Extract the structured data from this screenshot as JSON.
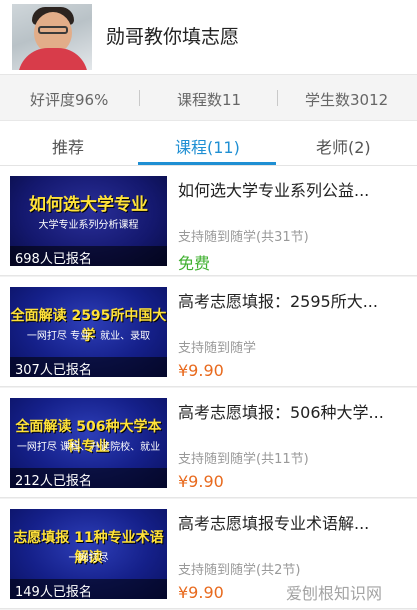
{
  "header": {
    "title": "勋哥教你填志愿"
  },
  "stats": {
    "rating": "好评度96%",
    "courses": "课程数11",
    "students": "学生数3012"
  },
  "tabs": [
    {
      "label": "推荐",
      "active": false
    },
    {
      "label": "课程(11)",
      "active": true
    },
    {
      "label": "老师(2)",
      "active": false
    }
  ],
  "courses": [
    {
      "title": "如何选大学专业系列公益...",
      "thumb_text": "如何选大学专业",
      "thumb_sub": "大学专业系列分析课程",
      "enrolled": "698人已报名",
      "meta": "支持随到随学(共31节)",
      "price": "免费"
    },
    {
      "title": "高考志愿填报：2595所大...",
      "thumb_text": "全面解读 2595所中国大学",
      "thumb_sub": "一网打尽 专业、就业、录取",
      "enrolled": "307人已报名",
      "meta": "支持随到随学",
      "price": "¥9.90"
    },
    {
      "title": "高考志愿填报：506种大学...",
      "thumb_text": "全面解读 506种大学本科专业",
      "thumb_sub": "一网打尽 课程、升读院校、就业",
      "enrolled": "212人已报名",
      "meta": "支持随到随学(共11节)",
      "price": "¥9.90"
    },
    {
      "title": "高考志愿填报专业术语解...",
      "thumb_text": "志愿填报 11种专业术语解读",
      "thumb_sub": "一网打尽",
      "enrolled": "149人已报名",
      "meta": "支持随到随学(共2节)",
      "price": "¥9.90"
    }
  ],
  "watermark": "爱刨根知识网"
}
